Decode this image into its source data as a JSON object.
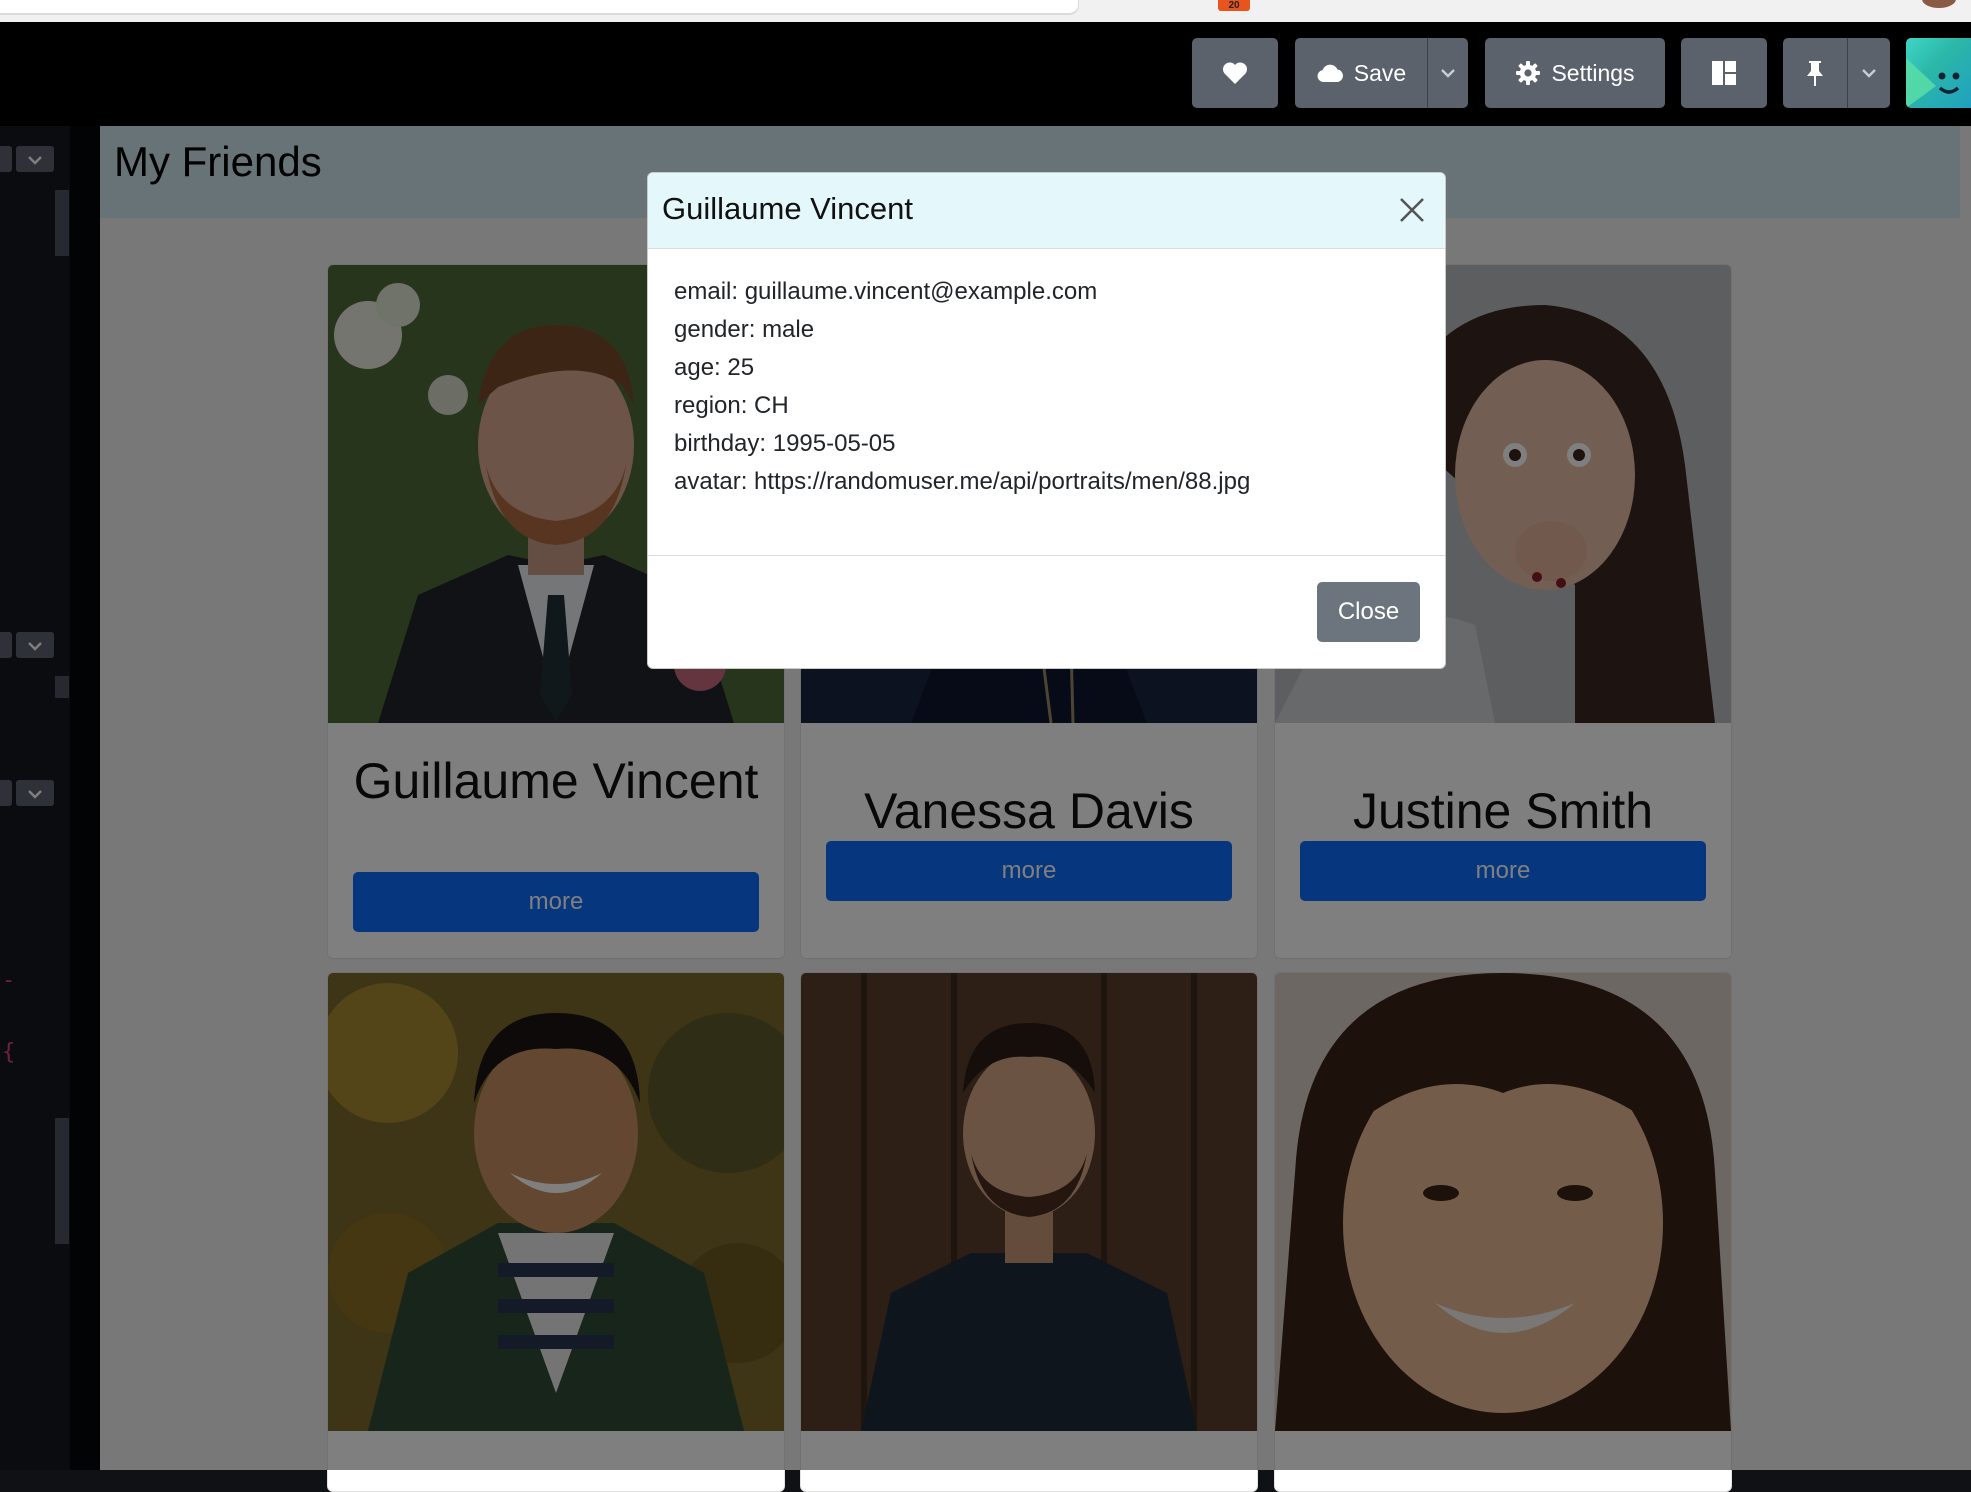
{
  "browser": {
    "extension_badge": "20"
  },
  "toolbar": {
    "save_label": "Save",
    "settings_label": "Settings",
    "icons": [
      "heart-icon",
      "cloud-icon",
      "chevron-down-icon",
      "gear-icon",
      "layout-icon",
      "pin-icon",
      "chevron-down-icon"
    ]
  },
  "editor": {
    "code_fragments": [
      "-",
      "{"
    ]
  },
  "page": {
    "title": "My Friends",
    "friends": [
      {
        "name": "Guillaume Vincent",
        "button": "more"
      },
      {
        "name": "Vanessa Davis",
        "button": "more"
      },
      {
        "name": "Justine Smith",
        "button": "more"
      },
      {
        "name": "",
        "button": ""
      },
      {
        "name": "",
        "button": ""
      },
      {
        "name": "",
        "button": ""
      }
    ]
  },
  "modal": {
    "title": "Guillaume Vincent",
    "lines": [
      "email: guillaume.vincent@example.com",
      "gender: male",
      "age: 25",
      "region: CH",
      "birthday: 1995-05-05",
      "avatar: https://randomuser.me/api/portraits/men/88.jpg"
    ],
    "close_label": "Close"
  },
  "colors": {
    "primary": "#0d6efd",
    "secondary": "#6c757d",
    "header_bg": "#cfe7ee",
    "modal_header_bg": "#e4f7fa",
    "toolbar_btn": "#5b626b"
  }
}
